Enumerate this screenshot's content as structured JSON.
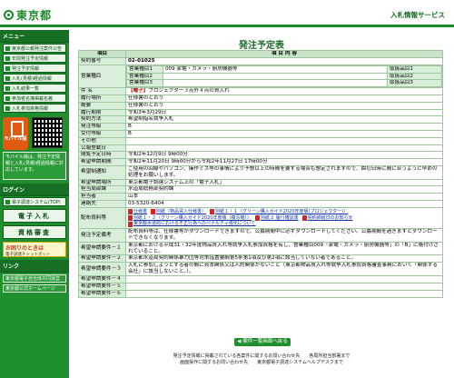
{
  "header": {
    "logo_text": "東京都",
    "site_title": "入札情報サービス"
  },
  "sidebar": {
    "menu_head": "メニュー",
    "items": [
      {
        "label": "東京都公報発注案件公告"
      },
      {
        "label": "年間発注予定情報"
      },
      {
        "label": "発注予定情報"
      },
      {
        "label": "入札(見積)経過情報"
      },
      {
        "label": "入札結果一覧"
      },
      {
        "label": "参加者名簿掲載名義"
      },
      {
        "label": "入札参加資格情報"
      }
    ],
    "mobile_label": "モバイル版",
    "mobile_note": "モバイル版は、発注予定情報と入札(見積)経過情報に対応しています。",
    "login_head": "ログイン",
    "e_bid_system": "電子調達システム(TOP)",
    "e_bid_label": "電子入札",
    "qualification_label": "資格審査",
    "help_title": "お困りのときは",
    "help_sub": "電子調達チャットボット",
    "links_head": "リンク",
    "link1": "東京都電子自治体共同運営",
    "link2": "東京都公式ホームページ"
  },
  "main": {
    "title": "発注予定表",
    "col_item": "項目",
    "col_content": "項 目 内 容",
    "rows": {
      "contract_no_label": "契約番号",
      "contract_no": "02-01025",
      "business_type_label": "営業種目",
      "bt1_label": "営業種目1",
      "bt1_value": "009 家電・カメラ・厨房機器等",
      "bt2_label": "営業種目2",
      "bt3_label": "営業種目3",
      "item1_label": "取扱品目1",
      "item2_label": "取扱品目2",
      "item3_label": "取扱品目3",
      "subject_label": "件 名",
      "subject_tag": "【電子】",
      "subject": "プロジェクター３点外４点の買入れ",
      "place_label": "履行場所",
      "place": "仕様書のとおり",
      "summary_label": "概要",
      "summary": "仕様書のとおり",
      "period_label": "履行期限",
      "period": "令和3年3月29日",
      "method_label": "契約方法",
      "method": "希望制指名競争入札",
      "org_label": "発注等級",
      "org": "B",
      "grade_label": "受付等級",
      "grade": "B",
      "other_label": "その他",
      "other": "",
      "pub_label": "公報登載日",
      "pub": "",
      "open_label": "閲覧予定日時",
      "open": "令和2年12月9日 9時00分",
      "apply_label": "希望申請期間",
      "apply": "令和2年11月20日 9時00分から令和2年11月27日 17時00分",
      "notice_label": "希望制通知",
      "notice": "ご使用の回線やパソコン、操作ミス等の事情により予想以上の時間を要する場合も想定されますので、締切日時に間に合うように早めの処理をお願いします。",
      "dept_label": "希望申請場所",
      "dept": "東京都電子調達システム上の「電子入札」",
      "bureau_label": "担当局部課",
      "bureau": "水道局総務部契約課",
      "person_label": "担当者",
      "person": "山本",
      "phone_label": "連絡先",
      "phone": "03-5320-6404",
      "docs_label": "配布資料等",
      "docs": [
        "仕様書",
        "別紙（物品買入仕様書）",
        "別紙１・１（グリーン購入ガイド2020年度版(プロジェクター)）",
        "別紙１・２（グリーン購入ガイド2020年度版（複写機））",
        "別紙２ 履行確認書",
        "契約締結日のお知らせ",
        "東京都水道局における不正行為へのペナルティ強化について"
      ],
      "remarks_label": "発注予定備考",
      "remarks": "配布資料等は、仕様書等がダウンロードできますので、公募期間中に必ずダウンロードしてください。公募期間を過ぎますとダウンロードできなくなります。",
      "req1_label": "希望申請要件－１",
      "req1": "東京都における平成31・32年度物品買入れ等競争入札参加資格を有し、営業種目009「家電・カメラ・厨房機器等」の「B」に格付けされていること。",
      "req2_label": "希望申請要件－２",
      "req2": "東京都水道局契約関係暴力団等対策措置要綱第5条第1項及び第2項に該当していない者であること。",
      "req3_label": "希望申請要件－３",
      "req3": "入札に参加しようとする者の間に資本関係又は人的関係がないこと（東京都物品買入れ等競争入札参加資格審査事務において「関係する会社」に該当しないこと。）。",
      "req4_label": "希望申請要件－４",
      "req5_label": "希望申請要件－５",
      "req6_label": "希望申請要件－６"
    },
    "back_button": "案件一覧画面へ戻る",
    "footer_line1": "発注予定情報に掲載されている各案件に関するお問い合わせ先　　各局所担当部署まで",
    "footer_line2": "画面操作に関するお問い合わせ先　　東京都電子調達システムヘルプデスクまで"
  }
}
